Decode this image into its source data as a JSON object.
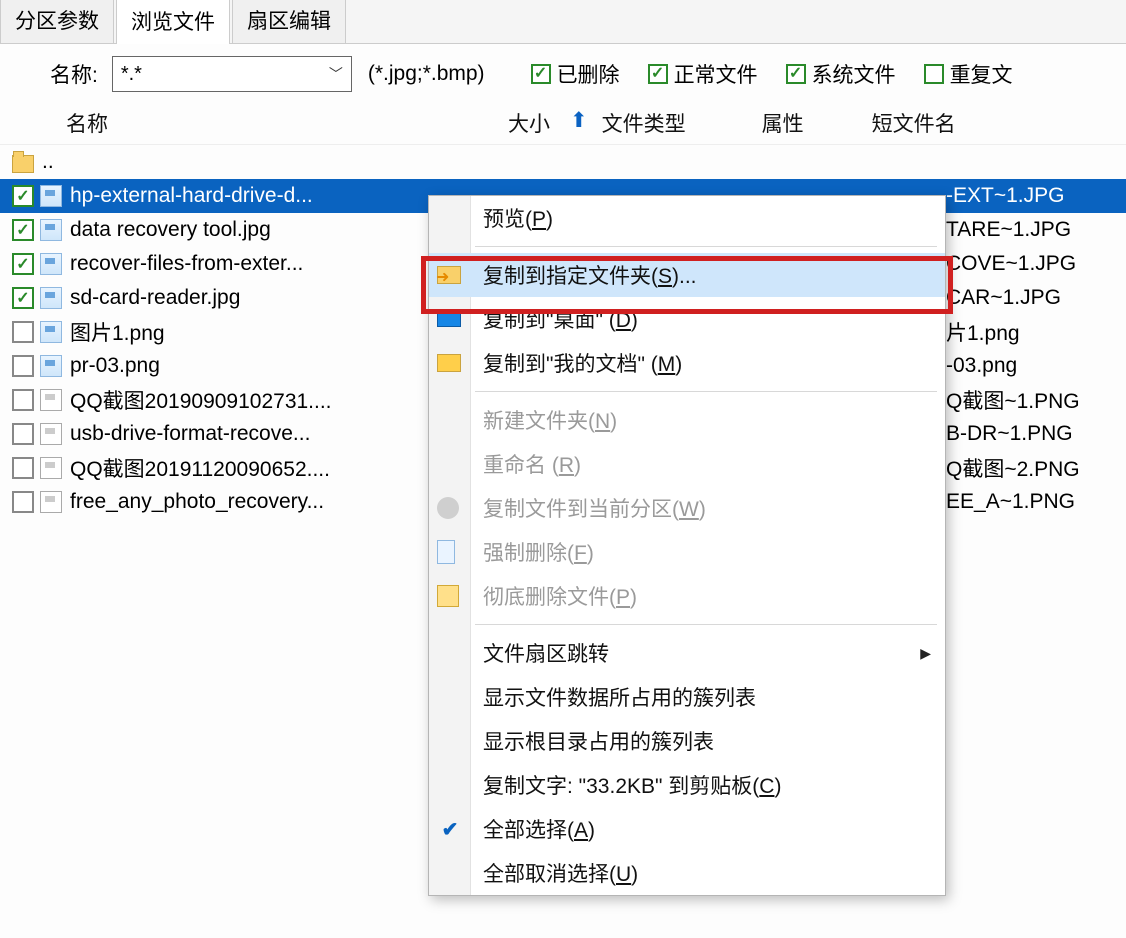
{
  "tabs": {
    "partition_params": "分区参数",
    "browse_files": "浏览文件",
    "sector_edit": "扇区编辑"
  },
  "filter": {
    "name_label": "名称:",
    "pattern_value": "*.*",
    "hint_text": "(*.jpg;*.bmp)",
    "chk_deleted": "已删除",
    "chk_normal": "正常文件",
    "chk_system": "系统文件",
    "chk_duplicate": "重复文"
  },
  "columns": {
    "name": "名称",
    "size": "大小",
    "type": "文件类型",
    "attr": "属性",
    "shortname": "短文件名"
  },
  "parent_dir": "..",
  "files": [
    {
      "checked": true,
      "grey": false,
      "name": "hp-external-hard-drive-d...",
      "short": "-EXT~1.JPG",
      "selected": true,
      "icon": "blue"
    },
    {
      "checked": true,
      "grey": false,
      "name": "data recovery tool.jpg",
      "short": "TARE~1.JPG",
      "selected": false,
      "icon": "blue"
    },
    {
      "checked": true,
      "grey": false,
      "name": "recover-files-from-exter...",
      "short": "COVE~1.JPG",
      "selected": false,
      "icon": "blue"
    },
    {
      "checked": true,
      "grey": false,
      "name": "sd-card-reader.jpg",
      "short": "CAR~1.JPG",
      "selected": false,
      "icon": "blue"
    },
    {
      "checked": false,
      "grey": true,
      "name": "图片1.png",
      "short": "片1.png",
      "selected": false,
      "icon": "blue"
    },
    {
      "checked": false,
      "grey": true,
      "name": "pr-03.png",
      "short": "-03.png",
      "selected": false,
      "icon": "blue"
    },
    {
      "checked": false,
      "grey": true,
      "name": "QQ截图20190909102731....",
      "short": "Q截图~1.PNG",
      "selected": false,
      "icon": "white"
    },
    {
      "checked": false,
      "grey": true,
      "name": "usb-drive-format-recove...",
      "short": "B-DR~1.PNG",
      "selected": false,
      "icon": "white"
    },
    {
      "checked": false,
      "grey": true,
      "name": "QQ截图20191120090652....",
      "short": "Q截图~2.PNG",
      "selected": false,
      "icon": "white"
    },
    {
      "checked": false,
      "grey": true,
      "name": "free_any_photo_recovery...",
      "short": "EE_A~1.PNG",
      "selected": false,
      "icon": "white"
    }
  ],
  "context_menu": {
    "preview": {
      "text": "预览",
      "accel": "P"
    },
    "copy_to_folder": {
      "text": "复制到指定文件夹",
      "accel": "S",
      "suffix": "..."
    },
    "copy_to_desktop": {
      "prefix": "复制到\"桌面\"  (",
      "accel": "D",
      "suffix": ")"
    },
    "copy_to_documents": {
      "prefix": "复制到\"我的文档\"  (",
      "accel": "M",
      "suffix": ")"
    },
    "new_folder": {
      "text": "新建文件夹",
      "accel": "N"
    },
    "rename": {
      "text": "重命名 (",
      "accel": "R",
      "suffix": ")"
    },
    "copy_to_partition": {
      "text": "复制文件到当前分区",
      "accel": "W"
    },
    "force_delete": {
      "text": "强制删除",
      "accel": "F"
    },
    "permanent_delete": {
      "text": "彻底删除文件",
      "accel": "P"
    },
    "sector_jump": "文件扇区跳转",
    "show_cluster_list": "显示文件数据所占用的簇列表",
    "show_root_cluster": "显示根目录占用的簇列表",
    "copy_text_clipboard": {
      "prefix": "复制文字: \"33.2KB\" 到剪贴板(",
      "accel": "C",
      "suffix": ")"
    },
    "select_all": {
      "text": "全部选择",
      "accel": "A"
    },
    "deselect_all": {
      "text": "全部取消选择",
      "accel": "U"
    }
  }
}
